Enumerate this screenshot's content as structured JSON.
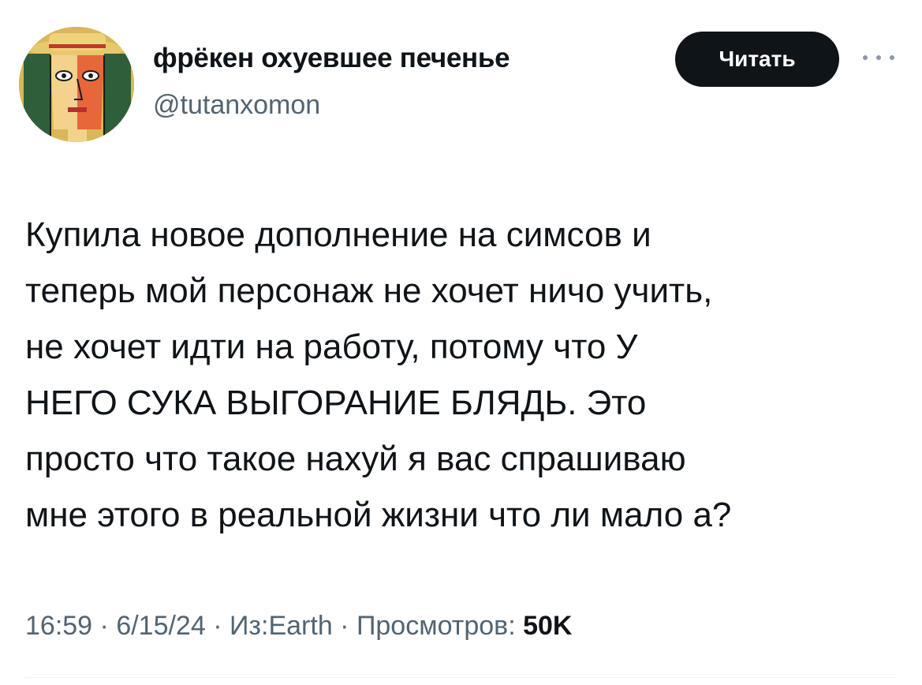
{
  "author": {
    "display_name": "фрёкен охуевшее печенье",
    "handle": "@tutanxomon",
    "avatar_icon": "cubist-portrait-avatar"
  },
  "follow_button": {
    "label": "Читать"
  },
  "more_icon": "more-horizontal-icon",
  "tweet": {
    "lines": [
      "Купила новое дополнение на симсов и",
      "теперь мой персонаж не хочет ничо учить,",
      "не хочет идти на работу, потому что У",
      "НЕГО СУКА ВЫГОРАНИЕ БЛЯДЬ. Это",
      "просто что такое нахуй я вас спрашиваю",
      "мне этого в реальной жизни что ли мало а?"
    ]
  },
  "meta": {
    "time": "16:59",
    "separator": " · ",
    "date": "6/15/24",
    "source": "Из:Earth",
    "views_label": "Просмотров:",
    "views_count": "50K"
  },
  "colors": {
    "text": "#0f1419",
    "secondary": "#536471",
    "button_bg": "#0f1419",
    "button_text": "#ffffff"
  }
}
